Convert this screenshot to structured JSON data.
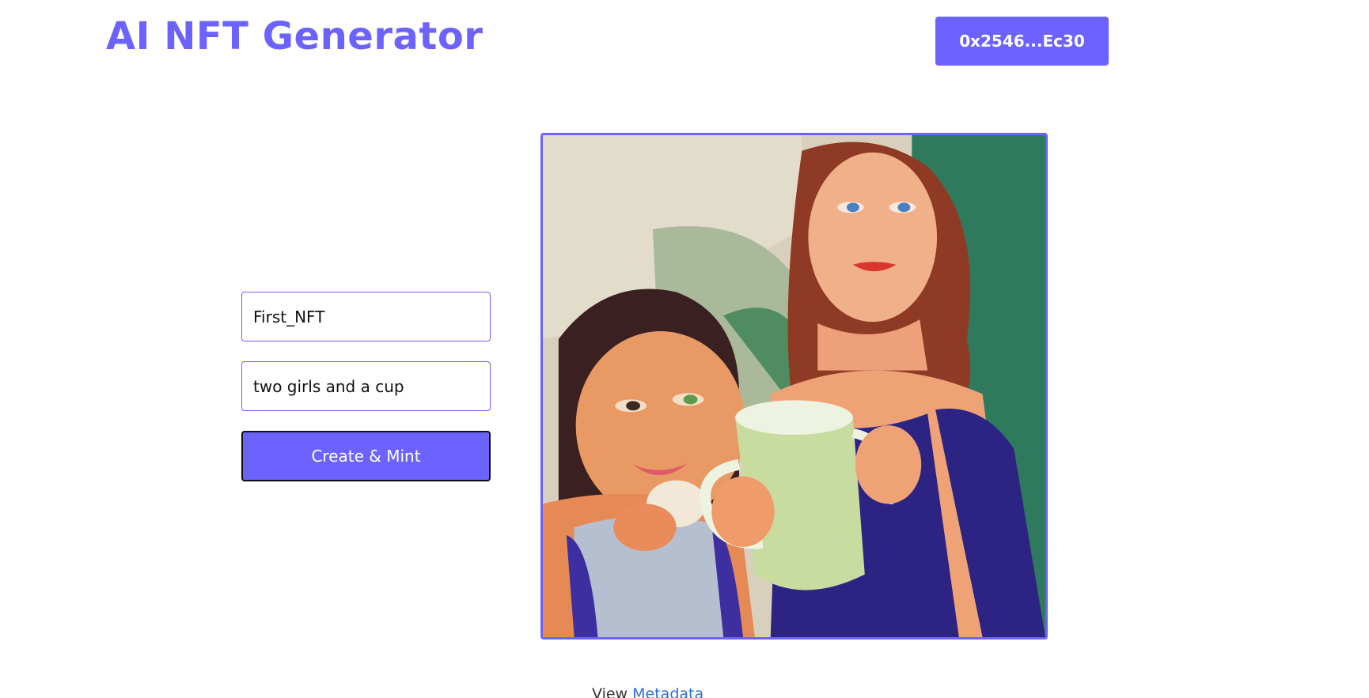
{
  "header": {
    "title": "AI NFT Generator",
    "wallet_label": "0x2546...Ec30"
  },
  "form": {
    "name_value": "First_NFT",
    "description_value": "two girls and a cup",
    "submit_label": "Create & Mint"
  },
  "image": {
    "alt": "two girls and a cup"
  },
  "footer": {
    "view_text": "View",
    "metadata_link": "Metadata"
  },
  "colors": {
    "accent": "#6c63ff",
    "link": "#2f6fd6"
  }
}
